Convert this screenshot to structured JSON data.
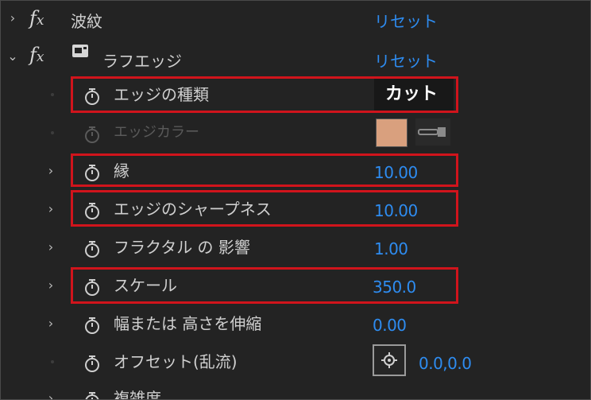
{
  "effects": [
    {
      "name": "波紋",
      "reset": "リセット"
    },
    {
      "name": "ラフエッジ",
      "reset": "リセット"
    }
  ],
  "properties": [
    {
      "label": "エッジの種類",
      "value": "カット"
    },
    {
      "label": "エッジカラー",
      "color": "#d9a07e"
    },
    {
      "label": "縁",
      "value": "10.00"
    },
    {
      "label": "エッジのシャープネス",
      "value": "10.00"
    },
    {
      "label": "フラクタル の 影響",
      "value": "1.00"
    },
    {
      "label": "スケール",
      "value": "350.0"
    },
    {
      "label": "幅または 高さを伸縮",
      "value": "0.00"
    },
    {
      "label": "オフセット(乱流)",
      "value": "0.0,0.0"
    },
    {
      "label": "複雑度",
      "value": ""
    }
  ],
  "colors": {
    "accent": "#2e8cf0",
    "highlight": "#d0141c"
  },
  "icons": {
    "stopwatch": "stopwatch-icon",
    "expand": "chevron-right-icon",
    "collapse": "chevron-down-icon",
    "fx": "fx-icon",
    "eyedropper": "eyedropper-icon",
    "anchor": "crosshair-icon"
  }
}
